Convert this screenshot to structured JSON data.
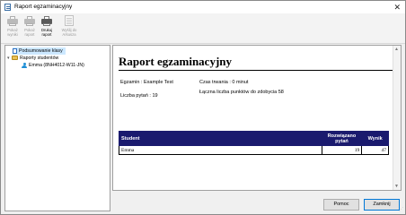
{
  "window": {
    "title": "Raport egzaminacyjny",
    "close": "✕"
  },
  "toolbar": {
    "buttons": [
      {
        "label": "Pokaż wyniki",
        "icon": "printer-icon",
        "enabled": false
      },
      {
        "label": "Pokaż raport",
        "icon": "printer-icon",
        "enabled": false
      },
      {
        "label": "Drukuj raport",
        "icon": "printer-icon",
        "enabled": true
      },
      {
        "label": "Wyślij do Arkusza",
        "icon": "spreadsheet-icon",
        "enabled": false
      }
    ]
  },
  "tree": {
    "items": [
      {
        "label": "Podsumowanie klasy",
        "icon": "document-icon",
        "selected": true
      },
      {
        "label": "Raporty studentów",
        "icon": "folder-icon",
        "expander": "▾"
      },
      {
        "label": "Emma (8NH4012-W11-JN)",
        "icon": "user-icon"
      }
    ]
  },
  "report": {
    "title": "Raport egzaminacyjny",
    "exam": "Egzamin : Example Test",
    "duration": "Czas trwania : 0 minut",
    "questions": "Liczba pytań : 19",
    "total_points": "Łączna liczba punktów do zdobycia 58",
    "table": {
      "headers": [
        "Student",
        "Rozwiązano pytań",
        "Wynik"
      ],
      "rows": [
        [
          "Emma",
          "19",
          "47"
        ]
      ]
    }
  },
  "buttons": {
    "help": "Pomoc",
    "close": "Zamknij"
  },
  "colors": {
    "table_header": "#1a1a6e",
    "selection": "#cce8ff",
    "primary_border": "#0078d7"
  }
}
